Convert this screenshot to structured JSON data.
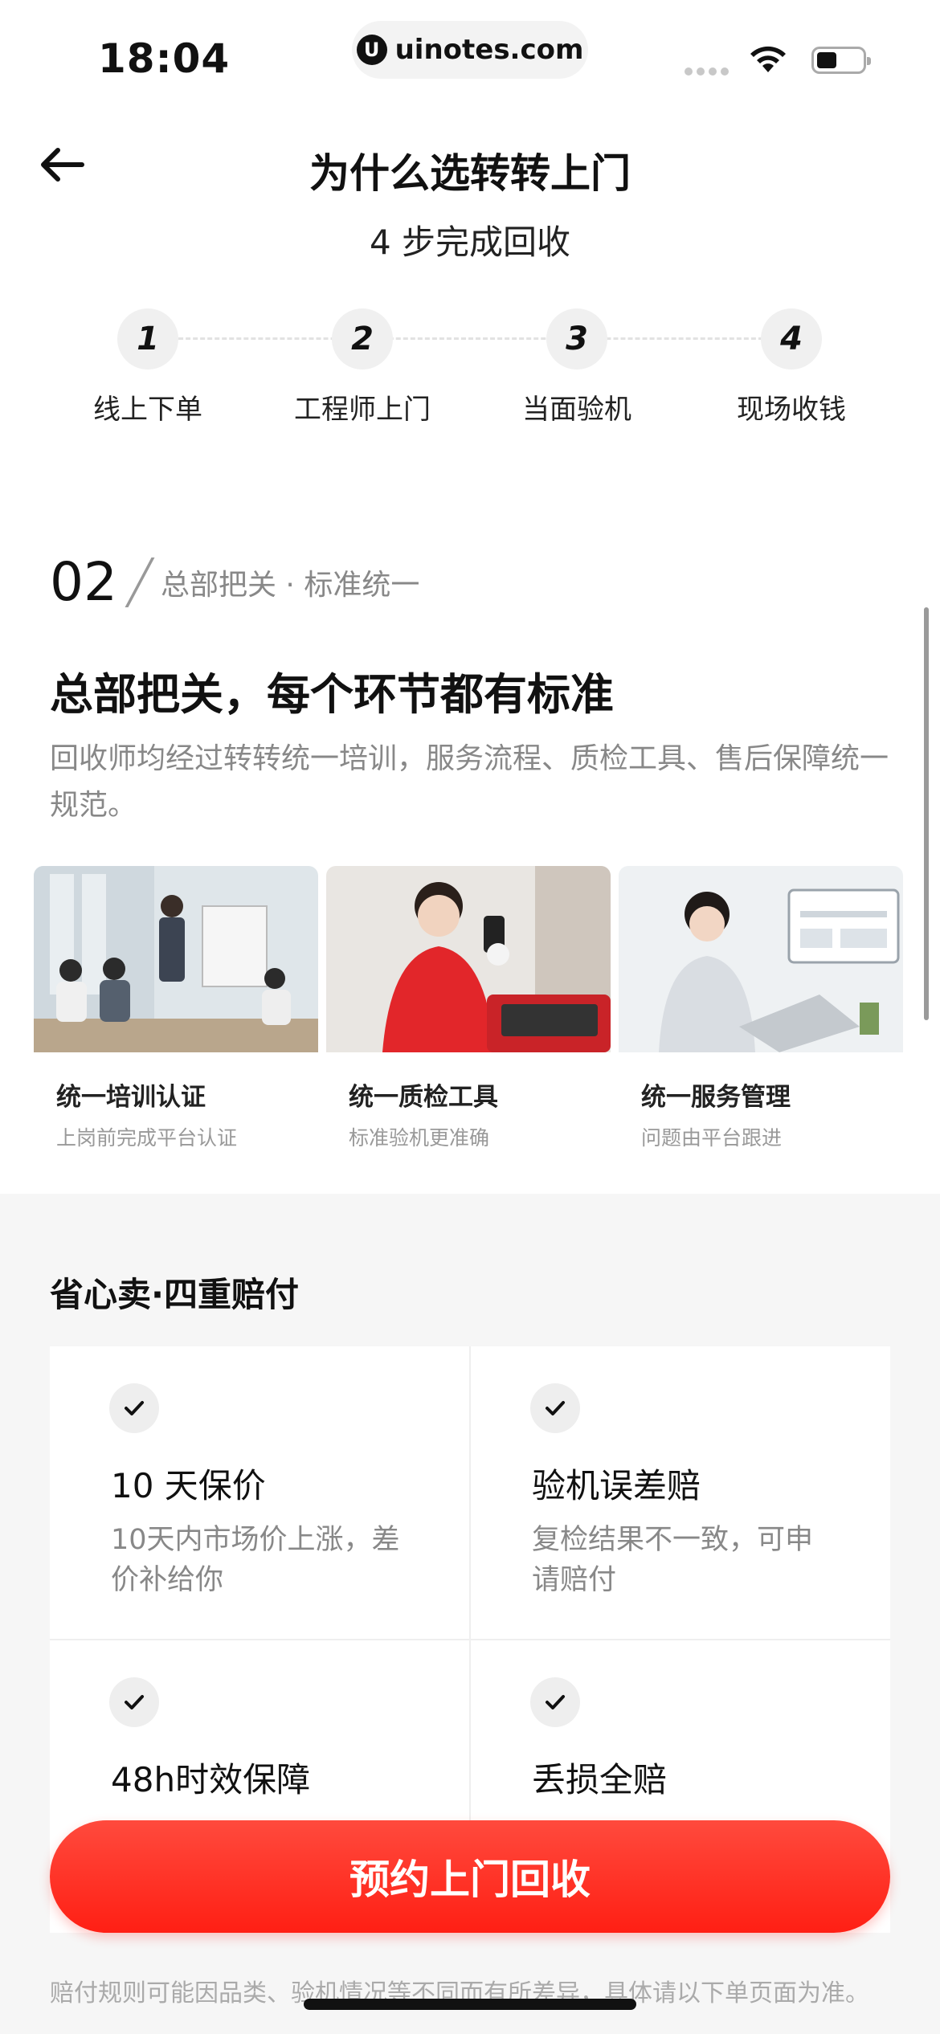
{
  "status_bar": {
    "time": "18:04",
    "url": "uinotes.com",
    "url_logo": "U"
  },
  "nav": {
    "title": "为什么选转转上门",
    "back_icon": "arrow-left-icon"
  },
  "steps": {
    "title": "4 步完成回收",
    "items": [
      {
        "num": "1",
        "label": "线上下单"
      },
      {
        "num": "2",
        "label": "工程师上门"
      },
      {
        "num": "3",
        "label": "当面验机"
      },
      {
        "num": "4",
        "label": "现场收钱"
      }
    ]
  },
  "section": {
    "number": "02",
    "subtitle": "总部把关 · 标准统一",
    "headline": "总部把关，每个环节都有标准",
    "description": "回收师均经过转转统一培训，服务流程、质检工具、售后保障统一规范。",
    "cards": [
      {
        "title": "统一培训认证",
        "subtitle": "上岗前完成平台认证"
      },
      {
        "title": "统一质检工具",
        "subtitle": "标准验机更准确"
      },
      {
        "title": "统一服务管理",
        "subtitle": "问题由平台跟进"
      }
    ]
  },
  "compensation": {
    "title": "省心卖·四重赔付",
    "items": [
      {
        "title": "10 天保价",
        "desc": "10天内市场价上涨，差价补给你"
      },
      {
        "title": "验机误差赔",
        "desc": "复检结果不一致，可申请赔付"
      },
      {
        "title": "48h时效保障",
        "desc": ""
      },
      {
        "title": "丢损全赔",
        "desc": ""
      }
    ]
  },
  "cta": {
    "label": "预约上门回收"
  },
  "footnote": "赔付规则可能因品类、验机情况等不同而有所差异，具体请以下单页面为准。",
  "colors": {
    "accent": "#ff2a1f",
    "muted": "#888888",
    "background_gray": "#f6f6f6"
  }
}
